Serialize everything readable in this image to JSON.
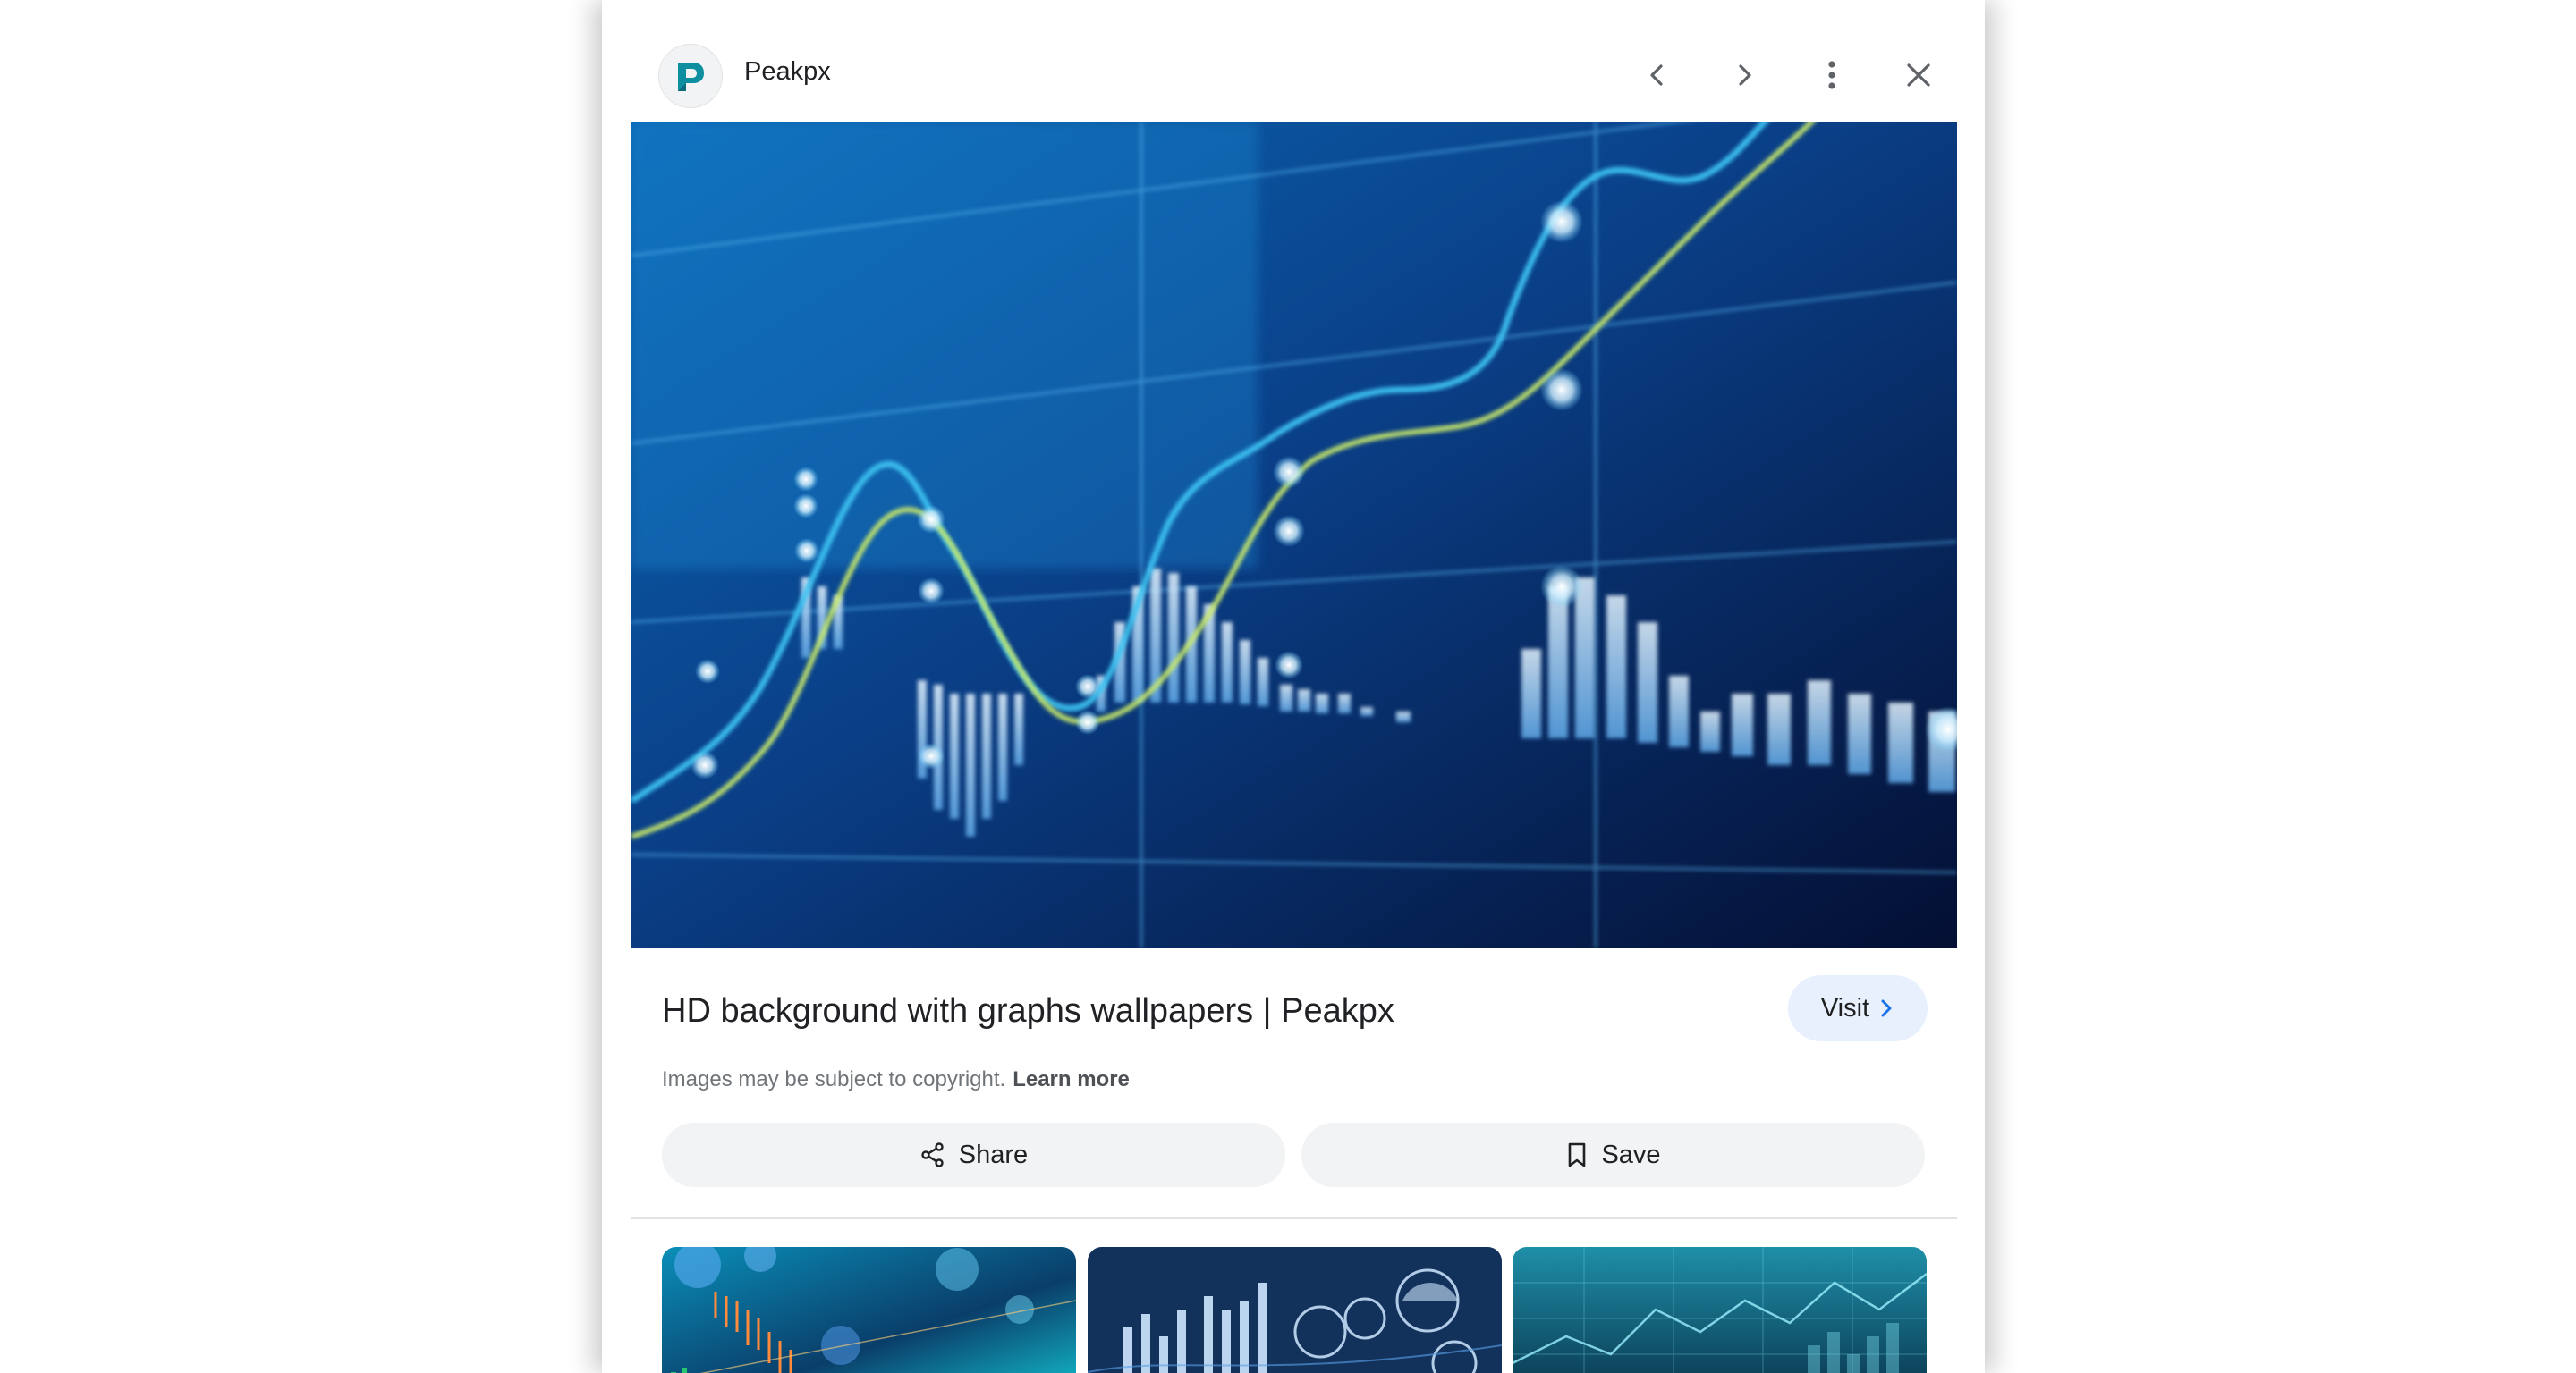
{
  "header": {
    "favicon_letter": "P",
    "source_name": "Peakpx"
  },
  "result": {
    "title": "HD background with graphs wallpapers | Peakpx",
    "visit_label": "Visit",
    "copyright_text": "Images may be subject to copyright.",
    "learn_more_label": "Learn more"
  },
  "actions": {
    "share_label": "Share",
    "save_label": "Save"
  },
  "colors": {
    "brand_teal": "#0e8fa0",
    "visit_bg": "#e8f0fe",
    "chip_bg": "#f1f3f4",
    "accent_blue": "#1a73e8"
  },
  "icons": [
    "previous-icon",
    "next-icon",
    "more-options-icon",
    "close-icon",
    "chevron-right-icon",
    "share-icon",
    "bookmark-icon"
  ]
}
